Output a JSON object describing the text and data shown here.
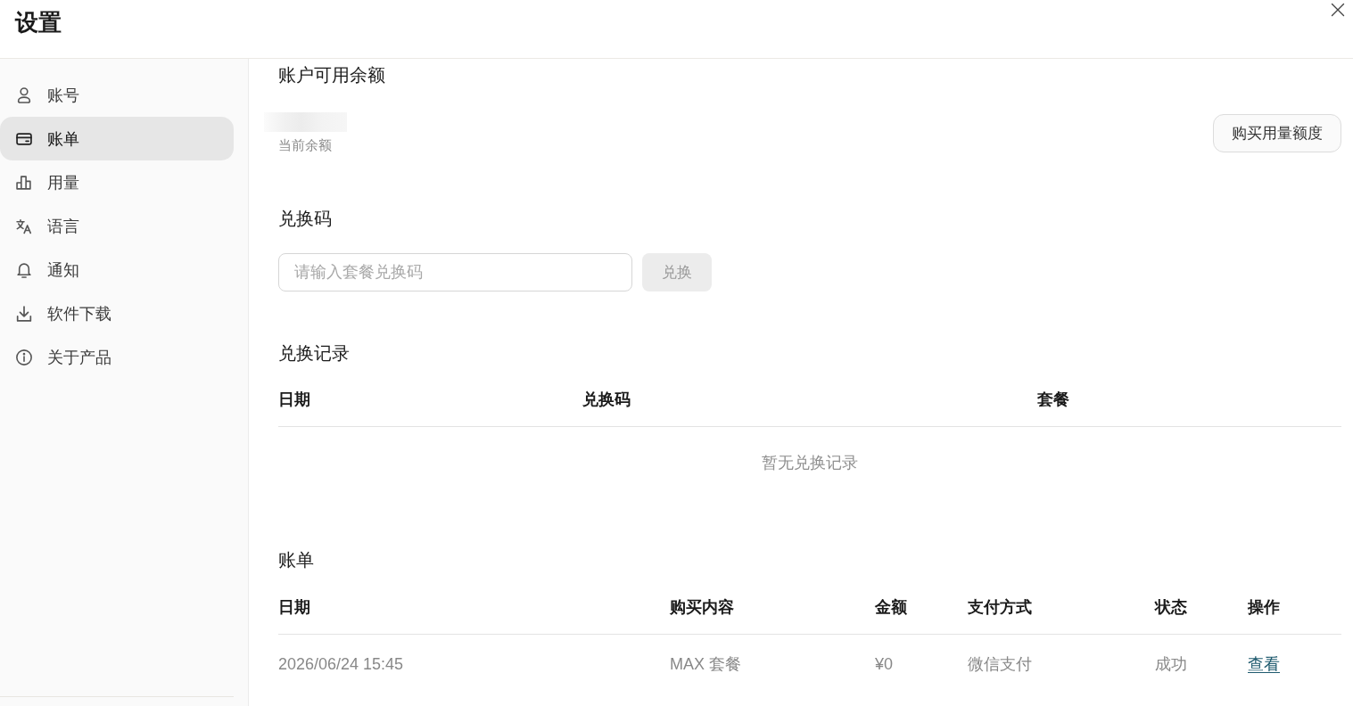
{
  "window": {
    "title": "设置"
  },
  "sidebar": {
    "items": [
      {
        "label": "账号",
        "selected": false
      },
      {
        "label": "账单",
        "selected": true
      },
      {
        "label": "用量",
        "selected": false
      },
      {
        "label": "语言",
        "selected": false
      },
      {
        "label": "通知",
        "selected": false
      },
      {
        "label": "软件下载",
        "selected": false
      },
      {
        "label": "关于产品",
        "selected": false
      }
    ]
  },
  "balance": {
    "title": "账户可用余额",
    "caption": "当前余额",
    "buy_button": "购买用量额度"
  },
  "redeem": {
    "title": "兑换码",
    "input": {
      "placeholder": "请输入套餐兑换码"
    },
    "button": {
      "label": "兑换",
      "disabled": true
    }
  },
  "redeem_history": {
    "title": "兑换记录",
    "table": {
      "columns": [
        "日期",
        "兑换码",
        "套餐"
      ],
      "empty_text": "暂无兑换记录"
    }
  },
  "bills": {
    "title": "账单",
    "table": {
      "columns": [
        "日期",
        "购买内容",
        "金额",
        "支付方式",
        "状态",
        "操作"
      ],
      "rows": [
        {
          "cells": [
            {
              "kind": "text",
              "text": "2026/06/24 15:45"
            },
            {
              "kind": "text",
              "text": "MAX 套餐"
            },
            {
              "kind": "text",
              "text": "¥0"
            },
            {
              "kind": "text",
              "text": "微信支付"
            },
            {
              "kind": "text",
              "text": "成功"
            },
            {
              "kind": "link",
              "text": "查看"
            }
          ]
        }
      ]
    }
  }
}
